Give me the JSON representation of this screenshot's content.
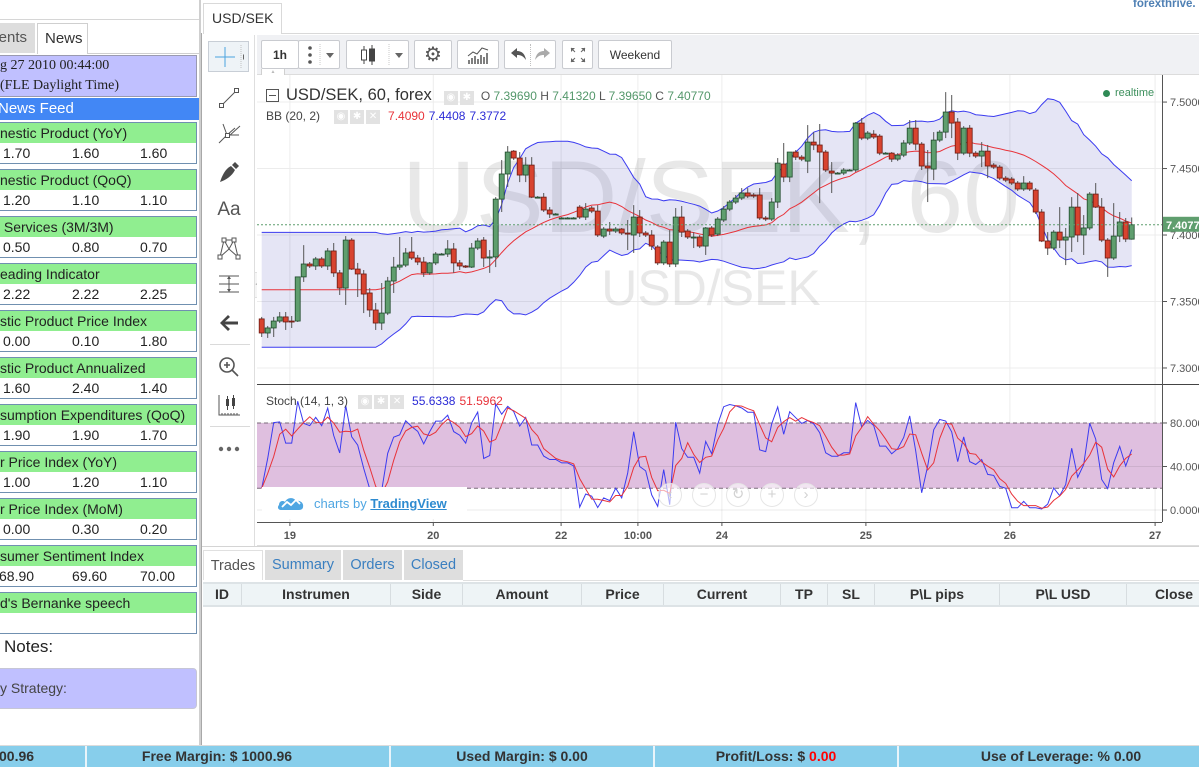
{
  "brand": "forexthrive.",
  "sidebar": {
    "tabs": [
      {
        "label": "ents",
        "active": false
      },
      {
        "label": "News",
        "active": true
      }
    ],
    "datetime_line1": "g 27 2010 00:44:00",
    "datetime_line2": "(FLE Daylight Time)",
    "feed_title": "News Feed",
    "news": [
      {
        "title": "nestic Product (YoY)",
        "values": [
          "1.70",
          "1.60",
          "1.60"
        ]
      },
      {
        "title": "nestic Product (QoQ)",
        "values": [
          "1.20",
          "1.10",
          "1.10"
        ]
      },
      {
        "title": " Services (3M/3M)",
        "values": [
          "0.50",
          "0.80",
          "0.70"
        ]
      },
      {
        "title": "eading Indicator",
        "values": [
          "2.22",
          "2.22",
          "2.25"
        ]
      },
      {
        "title": "stic Product Price Index",
        "values": [
          "0.00",
          "0.10",
          "1.80"
        ]
      },
      {
        "title": "stic Product Annualized",
        "values": [
          "1.60",
          "2.40",
          "1.40"
        ]
      },
      {
        "title": "sumption Expenditures (QoQ)",
        "values": [
          "1.90",
          "1.90",
          "1.70"
        ]
      },
      {
        "title": "r Price Index (YoY)",
        "values": [
          "1.00",
          "1.20",
          "1.10"
        ]
      },
      {
        "title": "r Price Index (MoM)",
        "values": [
          "0.00",
          "0.30",
          "0.20"
        ]
      },
      {
        "title": "sumer Sentiment Index",
        "values": [
          "68.90",
          "69.60",
          "70.00"
        ]
      },
      {
        "title": "d's Bernanke speech",
        "values": [
          "",
          "",
          ""
        ]
      }
    ],
    "notes_label": "Notes:",
    "strategy_label": "y Strategy:"
  },
  "chart_tab": "USD/SEK",
  "drawing_tools": {
    "icons": [
      "crosshair-icon",
      "trend-line-icon",
      "pitchfork-icon",
      "brush-icon",
      "text-icon",
      "pattern-icon",
      "projection-icon",
      "arrow-left-icon",
      "zoom-in-icon",
      "measure-icon",
      "more-icon"
    ],
    "text_tool_label": "Aa"
  },
  "toolbar": {
    "interval": "1h",
    "weekend": "Weekend",
    "icons": [
      "more-dots-icon",
      "chevron-down-icon",
      "candles-icon",
      "gear-icon",
      "indicators-icon",
      "undo-icon",
      "redo-icon",
      "fullscreen-icon"
    ]
  },
  "legend": {
    "symbol": "USD/SEK, 60, forex",
    "ohlc": [
      {
        "label": "O",
        "value": "7.39690"
      },
      {
        "label": "H",
        "value": "7.41320"
      },
      {
        "label": "L",
        "value": "7.39650"
      },
      {
        "label": "C",
        "value": "7.40770"
      }
    ],
    "bb_label": "BB (20, 2)",
    "bb_basis": "7.4090",
    "bb_upper": "7.4408",
    "bb_lower": "7.3772",
    "stoch_label": "Stoch (14, 1, 3)",
    "stoch_k": "55.6338",
    "stoch_d": "51.5962",
    "realtime": "realtime"
  },
  "chart_data": {
    "type": "candlestick",
    "title": "USD/SEK, 60, forex",
    "watermark": "USD/SEK, 60",
    "watermark_sub": "USD/SEK",
    "interval": "60",
    "ylim": [
      7.2887,
      7.5196
    ],
    "y_ticks": [
      {
        "value": 7.5,
        "label": "7.50000"
      },
      {
        "value": 7.45,
        "label": "7.45000"
      },
      {
        "value": 7.4,
        "label": "7.40000"
      },
      {
        "value": 7.35,
        "label": "7.35000"
      },
      {
        "value": 7.3,
        "label": "7.30000"
      }
    ],
    "x_ticks": [
      {
        "bar": 4.7,
        "label": "19"
      },
      {
        "bar": 28.6,
        "label": "20"
      },
      {
        "bar": 49.9,
        "label": "22"
      },
      {
        "bar": 62.7,
        "label": "10:00"
      },
      {
        "bar": 76.7,
        "label": "24"
      },
      {
        "bar": 100.7,
        "label": "25"
      },
      {
        "bar": 124.7,
        "label": "26"
      },
      {
        "bar": 148.9,
        "label": "27"
      }
    ],
    "last_price": 7.4077,
    "last_price_label": "7.40770",
    "bollinger": {
      "length": 20,
      "mult": 2
    },
    "stochastic": {
      "k_length": 14,
      "k_smooth": 1,
      "d_length": 3,
      "upper_band": 80,
      "lower_band": 20,
      "ylim": [
        -11.0,
        114.9
      ],
      "y_ticks": [
        {
          "value": 80,
          "label": "80.0000"
        },
        {
          "value": 40,
          "label": "40.0000"
        },
        {
          "value": 0,
          "label": "0.0000"
        }
      ]
    },
    "colors": {
      "up": "#5f9e6e",
      "up_border": "#1e4a2a",
      "down": "#d8432f",
      "down_border": "#6b1a12",
      "wick": "#555555",
      "bb_band": "#3b3bf0",
      "bb_basis": "#e8333a",
      "bb_fill": "rgba(80,80,190,0.15)",
      "stoch_k": "#3b3bf0",
      "stoch_d": "#e8333a",
      "stoch_band": "#dfbfdf",
      "last_label": "#5f9e6e"
    },
    "candles_format": [
      "open",
      "high",
      "low",
      "close"
    ],
    "candles": [
      [
        7.3369,
        7.3384,
        7.3233,
        7.3263
      ],
      [
        7.3263,
        7.3316,
        7.3226,
        7.3301
      ],
      [
        7.3301,
        7.3384,
        7.3233,
        7.3353
      ],
      [
        7.3353,
        7.3421,
        7.3338,
        7.3384
      ],
      [
        7.3384,
        7.3421,
        7.3286,
        7.3346
      ],
      [
        7.3353,
        7.3391,
        7.3301,
        7.3346
      ],
      [
        7.3353,
        7.3685,
        7.3346,
        7.3685
      ],
      [
        7.3685,
        7.3924,
        7.3647,
        7.3782
      ],
      [
        7.3782,
        7.3797,
        7.3752,
        7.3767
      ],
      [
        7.3767,
        7.3835,
        7.3737,
        7.382
      ],
      [
        7.382,
        7.3835,
        7.3752,
        7.3767
      ],
      [
        7.3767,
        7.3902,
        7.3737,
        7.388
      ],
      [
        7.388,
        7.394,
        7.3685,
        7.3715
      ],
      [
        7.3715,
        7.3737,
        7.3549,
        7.3601
      ],
      [
        7.3601,
        7.3992,
        7.3474,
        7.3962
      ],
      [
        7.3962,
        7.3977,
        7.3737,
        7.3744
      ],
      [
        7.3744,
        7.379,
        7.3534,
        7.3707
      ],
      [
        7.3707,
        7.3737,
        7.3413,
        7.3556
      ],
      [
        7.3564,
        7.3601,
        7.3384,
        7.3436
      ],
      [
        7.3436,
        7.3489,
        7.3286,
        7.3338
      ],
      [
        7.3338,
        7.3639,
        7.3286,
        7.3413
      ],
      [
        7.3413,
        7.3685,
        7.3398,
        7.3654
      ],
      [
        7.3654,
        7.3835,
        7.3564,
        7.3759
      ],
      [
        7.3759,
        7.3985,
        7.3737,
        7.3774
      ],
      [
        7.3774,
        7.3902,
        7.3759,
        7.3865
      ],
      [
        7.3872,
        7.3985,
        7.3812,
        7.3827
      ],
      [
        7.3827,
        7.385,
        7.3774,
        7.3797
      ],
      [
        7.3797,
        7.3835,
        7.3685,
        7.3715
      ],
      [
        7.3715,
        7.3797,
        7.37,
        7.379
      ],
      [
        7.379,
        7.3872,
        7.3774,
        7.3857
      ],
      [
        7.3857,
        7.3865,
        7.385,
        7.3857
      ],
      [
        7.3857,
        7.3962,
        7.3835,
        7.3895
      ],
      [
        7.3895,
        7.394,
        7.3715,
        7.379
      ],
      [
        7.379,
        7.3812,
        7.3737,
        7.3767
      ],
      [
        7.3767,
        7.3774,
        7.3752,
        7.3759
      ],
      [
        7.3759,
        7.394,
        7.3752,
        7.3902
      ],
      [
        7.3902,
        7.3977,
        7.3887,
        7.3955
      ],
      [
        7.3962,
        7.3985,
        7.3759,
        7.3827
      ],
      [
        7.3827,
        7.3887,
        7.3715,
        7.3835
      ],
      [
        7.3835,
        7.4285,
        7.3759,
        7.427
      ],
      [
        7.427,
        7.4564,
        7.4173,
        7.4459
      ],
      [
        7.4459,
        7.4669,
        7.4361,
        7.4624
      ],
      [
        7.4631,
        7.4639,
        7.4564,
        7.4579
      ],
      [
        7.4579,
        7.4624,
        7.4398,
        7.4451
      ],
      [
        7.4451,
        7.4586,
        7.4398,
        7.4526
      ],
      [
        7.4526,
        7.4586,
        7.4278,
        7.4285
      ],
      [
        7.4285,
        7.4293,
        7.4278,
        7.4285
      ],
      [
        7.4285,
        7.4316,
        7.4173,
        7.4188
      ],
      [
        7.4188,
        7.421,
        7.4128,
        7.4158
      ],
      [
        7.4158,
        7.4165,
        7.415,
        7.4158
      ],
      [
        7.4128,
        7.4135,
        7.412,
        7.4128
      ],
      [
        7.4128,
        7.4135,
        7.412,
        7.4128
      ],
      [
        7.4128,
        7.4135,
        7.412,
        7.4128
      ],
      [
        7.421,
        7.4225,
        7.412,
        7.4135
      ],
      [
        7.4135,
        7.424,
        7.4113,
        7.4195
      ],
      [
        7.4203,
        7.4218,
        7.4165,
        7.418
      ],
      [
        7.418,
        7.4225,
        7.3985,
        7.4
      ],
      [
        7.3992,
        7.406,
        7.3977,
        7.4045
      ],
      [
        7.4045,
        7.4098,
        7.4,
        7.403
      ],
      [
        7.403,
        7.406,
        7.4015,
        7.4045
      ],
      [
        7.4045,
        7.4053,
        7.4,
        7.4015
      ],
      [
        7.4015,
        7.4113,
        7.3887,
        7.4007
      ],
      [
        7.4,
        7.4225,
        7.3865,
        7.4135
      ],
      [
        7.4135,
        7.4188,
        7.3985,
        7.4015
      ],
      [
        7.4015,
        7.403,
        7.3985,
        7.4
      ],
      [
        7.4,
        7.4037,
        7.3887,
        7.3917
      ],
      [
        7.391,
        7.3924,
        7.3774,
        7.379
      ],
      [
        7.379,
        7.3962,
        7.3774,
        7.3947
      ],
      [
        7.3947,
        7.4037,
        7.3759,
        7.3782
      ],
      [
        7.3782,
        7.4203,
        7.3759,
        7.4135
      ],
      [
        7.4135,
        7.4218,
        7.3985,
        7.4022
      ],
      [
        7.403,
        7.4045,
        7.397,
        7.3985
      ],
      [
        7.3985,
        7.4022,
        7.3902,
        7.3985
      ],
      [
        7.3985,
        7.4,
        7.3902,
        7.3917
      ],
      [
        7.3917,
        7.406,
        7.385,
        7.4053
      ],
      [
        7.4053,
        7.4068,
        7.3985,
        7.4
      ],
      [
        7.4007,
        7.4135,
        7.3992,
        7.412
      ],
      [
        7.4113,
        7.4218,
        7.4098,
        7.4195
      ],
      [
        7.4195,
        7.4263,
        7.418,
        7.4248
      ],
      [
        7.4248,
        7.4301,
        7.4233,
        7.4278
      ],
      [
        7.4278,
        7.4353,
        7.4263,
        7.4316
      ],
      [
        7.4316,
        7.4353,
        7.4278,
        7.4293
      ],
      [
        7.4301,
        7.4316,
        7.4278,
        7.4293
      ],
      [
        7.4301,
        7.4353,
        7.4113,
        7.4128
      ],
      [
        7.4128,
        7.4143,
        7.4105,
        7.412
      ],
      [
        7.412,
        7.4278,
        7.4105,
        7.4248
      ],
      [
        7.4248,
        7.4579,
        7.4203,
        7.4541
      ],
      [
        7.4534,
        7.4692,
        7.4398,
        7.4436
      ],
      [
        7.4436,
        7.4624,
        7.4398,
        7.4624
      ],
      [
        7.4624,
        7.4639,
        7.4564,
        7.4586
      ],
      [
        7.4586,
        7.4601,
        7.4556,
        7.4571
      ],
      [
        7.4556,
        7.4827,
        7.4466,
        7.4699
      ],
      [
        7.4699,
        7.4774,
        7.4639,
        7.4677
      ],
      [
        7.4677,
        7.4835,
        7.424,
        7.4624
      ],
      [
        7.4624,
        7.4639,
        7.4474,
        7.4489
      ],
      [
        7.4481,
        7.4549,
        7.4316,
        7.4466
      ],
      [
        7.4466,
        7.4474,
        7.4459,
        7.4466
      ],
      [
        7.4466,
        7.4504,
        7.4451,
        7.4489
      ],
      [
        7.4489,
        7.4496,
        7.4481,
        7.4489
      ],
      [
        7.4489,
        7.485,
        7.4474,
        7.4842
      ],
      [
        7.4842,
        7.488,
        7.4714,
        7.4729
      ],
      [
        7.4729,
        7.4782,
        7.4714,
        7.4767
      ],
      [
        7.4759,
        7.4789,
        7.4722,
        7.4737
      ],
      [
        7.4744,
        7.4759,
        7.4601,
        7.4616
      ],
      [
        7.4616,
        7.4624,
        7.4609,
        7.4616
      ],
      [
        7.4616,
        7.4624,
        7.4549,
        7.4571
      ],
      [
        7.4571,
        7.4616,
        7.4556,
        7.4601
      ],
      [
        7.4601,
        7.4714,
        7.4586,
        7.4692
      ],
      [
        7.4692,
        7.4865,
        7.4677,
        7.4804
      ],
      [
        7.4804,
        7.4865,
        7.4639,
        7.4684
      ],
      [
        7.4684,
        7.4699,
        7.4489,
        7.4519
      ],
      [
        7.4519,
        7.4639,
        7.4248,
        7.4504
      ],
      [
        7.4496,
        7.4774,
        7.4413,
        7.4714
      ],
      [
        7.4714,
        7.4789,
        7.4699,
        7.4774
      ],
      [
        7.4774,
        7.5075,
        7.4729,
        7.4925
      ],
      [
        7.4925,
        7.5053,
        7.4729,
        7.4842
      ],
      [
        7.485,
        7.488,
        7.4564,
        7.4616
      ],
      [
        7.4616,
        7.4819,
        7.4601,
        7.4804
      ],
      [
        7.4804,
        7.4827,
        7.4586,
        7.4616
      ],
      [
        7.4616,
        7.4631,
        7.4579,
        7.4594
      ],
      [
        7.4594,
        7.4699,
        7.4511,
        7.4631
      ],
      [
        7.4631,
        7.4677,
        7.4428,
        7.4519
      ],
      [
        7.4526,
        7.4541,
        7.4496,
        7.4511
      ],
      [
        7.4511,
        7.4526,
        7.4413,
        7.4428
      ],
      [
        7.4428,
        7.4443,
        7.4398,
        7.4413
      ],
      [
        7.4421,
        7.4436,
        7.4376,
        7.4391
      ],
      [
        7.4391,
        7.4406,
        7.4331,
        7.4346
      ],
      [
        7.4346,
        7.4443,
        7.4331,
        7.4391
      ],
      [
        7.4391,
        7.4406,
        7.4331,
        7.4346
      ],
      [
        7.4338,
        7.4353,
        7.4158,
        7.4173
      ],
      [
        7.4173,
        7.4195,
        7.3947,
        7.3955
      ],
      [
        7.3955,
        7.4022,
        7.385,
        7.3902
      ],
      [
        7.3902,
        7.4037,
        7.3887,
        7.4022
      ],
      [
        7.4022,
        7.421,
        7.3902,
        7.3962
      ],
      [
        7.3962,
        7.4053,
        7.3774,
        7.3985
      ],
      [
        7.3985,
        7.4285,
        7.3872,
        7.421
      ],
      [
        7.421,
        7.4316,
        7.3947,
        7.4
      ],
      [
        7.4,
        7.415,
        7.385,
        7.4053
      ],
      [
        7.4053,
        7.4323,
        7.4037,
        7.4308
      ],
      [
        7.4308,
        7.4391,
        7.4203,
        7.421
      ],
      [
        7.421,
        7.4278,
        7.3947,
        7.3962
      ],
      [
        7.3962,
        7.3977,
        7.3685,
        7.3827
      ],
      [
        7.3827,
        7.424,
        7.3812,
        7.3992
      ],
      [
        7.3992,
        7.4173,
        7.3947,
        7.4098
      ],
      [
        7.4098,
        7.4128,
        7.3947,
        7.397
      ],
      [
        7.3969,
        7.4132,
        7.3965,
        7.4077
      ]
    ]
  },
  "tradingview": {
    "prefix": "charts by ",
    "name": "TradingView",
    "icon": "tradingview-cloud-icon"
  },
  "nav_buttons": [
    {
      "icon": "scroll-left-icon",
      "glyph": "‹"
    },
    {
      "icon": "zoom-out-icon",
      "glyph": "−"
    },
    {
      "icon": "reset-icon",
      "glyph": "↻"
    },
    {
      "icon": "zoom-in-icon",
      "glyph": "+"
    },
    {
      "icon": "scroll-right-icon",
      "glyph": "›"
    }
  ],
  "trades": {
    "tabs": [
      {
        "label": "Trades",
        "active": true
      },
      {
        "label": "Summary",
        "active": false
      },
      {
        "label": "Orders",
        "active": false
      },
      {
        "label": "Closed",
        "active": false
      }
    ],
    "columns": [
      "ID",
      "Instrumen",
      "Side",
      "Amount",
      "Price",
      "Current",
      "TP",
      "SL",
      "P\\L pips",
      "P\\L USD",
      "Close"
    ],
    "rows": []
  },
  "footer": {
    "balance": "00.96",
    "free_margin": "Free Margin: $ 1000.96",
    "used_margin": "Used Margin: $ 0.00",
    "profit_loss_label": "Profit/Loss: $ ",
    "profit_loss_value": "0.00",
    "profit_loss_color": "#ff0000",
    "leverage": "Use of Leverage: % 0.00"
  }
}
